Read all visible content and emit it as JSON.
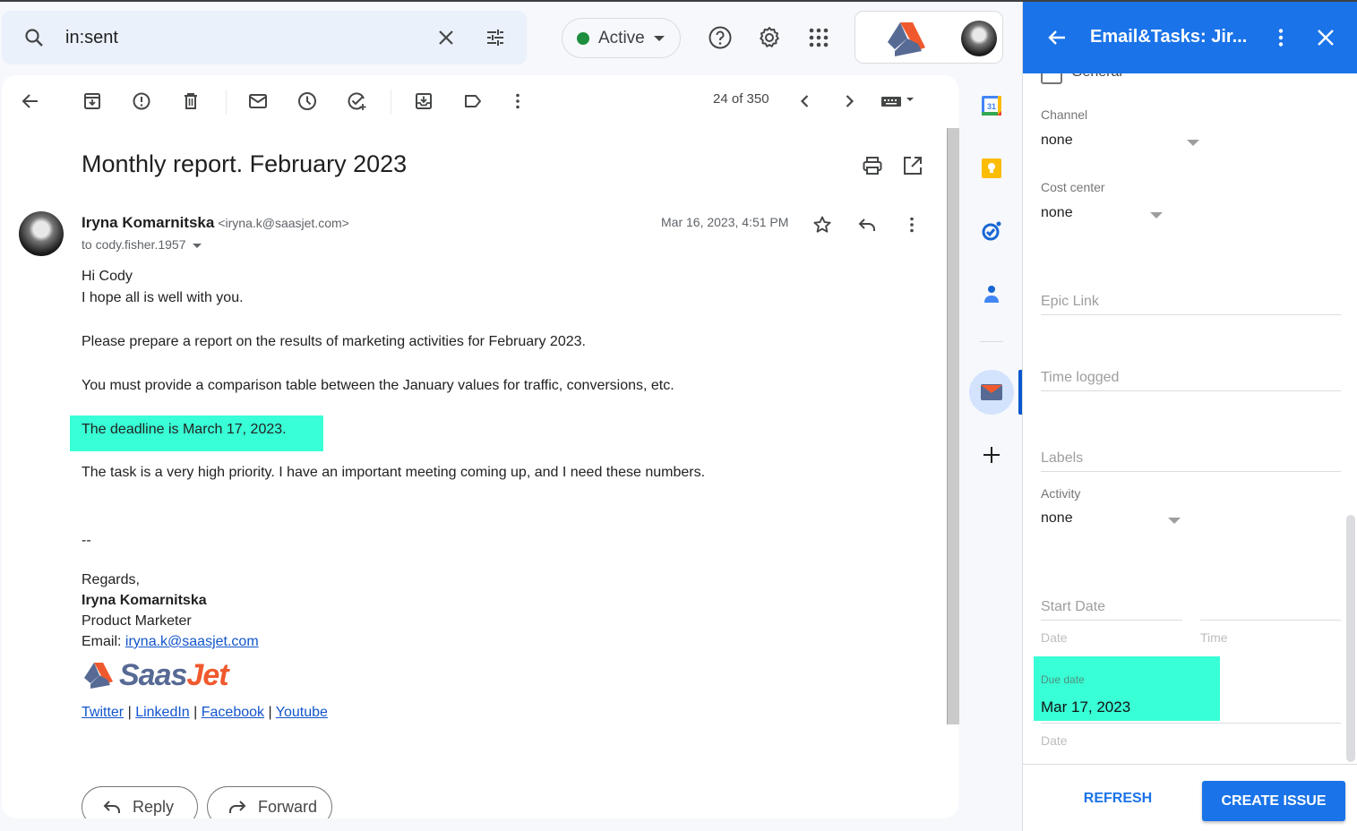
{
  "search": {
    "query": "in:sent",
    "search_icon": "search-icon",
    "clear_icon": "close-icon",
    "filters_icon": "tune-icon"
  },
  "status": {
    "label": "Active",
    "color": "#1e8e3e"
  },
  "header_icons": [
    "help-icon",
    "settings-icon",
    "apps-grid-icon"
  ],
  "toolbar": {
    "icons": [
      "back-arrow-icon",
      "archive-icon",
      "report-spam-icon",
      "delete-icon",
      "mark-unread-icon",
      "snooze-icon",
      "add-task-icon",
      "move-to-icon",
      "label-icon",
      "more-icon"
    ],
    "pager": "24 of 350"
  },
  "email": {
    "subject": "Monthly report. February 2023",
    "sender_name": "Iryna Komarnitska",
    "sender_email": "<iryna.k@saasjet.com>",
    "to": "to cody.fisher.1957",
    "date": "Mar 16, 2023, 4:51 PM",
    "body": [
      "Hi Cody",
      "I hope all is well with you.",
      "Please prepare a report on the results of marketing activities for February 2023.",
      "You must provide a comparison table between the January values for traffic, conversions, etc.",
      "The deadline is March 17, 2023.",
      "The task is a very high priority. I have an important meeting coming up, and I need these numbers.",
      "--",
      "Regards,"
    ],
    "signature": {
      "name": "Iryna Komarnitska",
      "title": "Product Marketer",
      "email_label": "Email:",
      "email": "iryna.k@saasjet.com",
      "brand_a": "Saas",
      "brand_b": "Jet",
      "links": [
        "Twitter",
        "LinkedIn",
        "Facebook",
        "Youtube"
      ],
      "separator": "|"
    },
    "highlight_color": "#38ffd6"
  },
  "actions": {
    "reply": "Reply",
    "forward": "Forward"
  },
  "side_rail": [
    "calendar-icon",
    "keep-icon",
    "tasks-icon",
    "contacts-icon",
    "email-tasks-addon-icon",
    "add-icon"
  ],
  "panel": {
    "title": "Email&Tasks: Jir...",
    "general_label": "General",
    "fields": {
      "channel": {
        "label": "Channel",
        "value": "none"
      },
      "cost_center": {
        "label": "Cost center",
        "value": "none"
      },
      "epic_link": {
        "placeholder": "Epic Link"
      },
      "time_logged": {
        "placeholder": "Time logged"
      },
      "labels": {
        "placeholder": "Labels"
      },
      "activity": {
        "label": "Activity",
        "value": "none"
      },
      "start_date": {
        "placeholder": "Start Date",
        "date_hint": "Date",
        "time_hint": "Time"
      },
      "due_date": {
        "label": "Due date",
        "value": "Mar 17, 2023",
        "date_hint": "Date"
      }
    },
    "refresh": "REFRESH",
    "create": "CREATE ISSUE",
    "accent": "#1a73e8"
  }
}
